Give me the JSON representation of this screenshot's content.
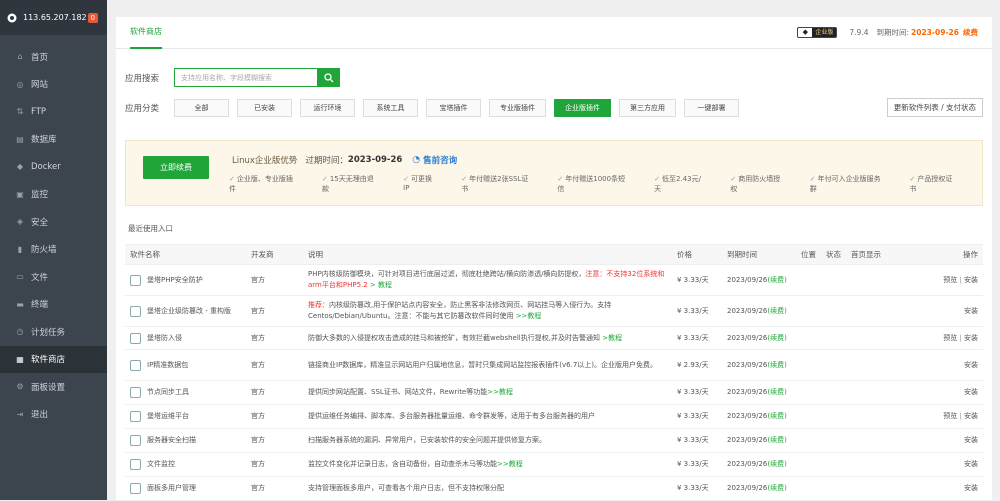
{
  "sidebar": {
    "ip": "113.65.207.182",
    "badge": "0",
    "items": [
      {
        "label": "首页",
        "icon": "home-icon",
        "glyph": "⌂"
      },
      {
        "label": "网站",
        "icon": "globe-icon",
        "glyph": "◎"
      },
      {
        "label": "FTP",
        "icon": "ftp-icon",
        "glyph": "⇅"
      },
      {
        "label": "数据库",
        "icon": "database-icon",
        "glyph": "▤"
      },
      {
        "label": "Docker",
        "icon": "docker-icon",
        "glyph": "◆"
      },
      {
        "label": "监控",
        "icon": "monitor-icon",
        "glyph": "▣"
      },
      {
        "label": "安全",
        "icon": "shield-icon",
        "glyph": "◈"
      },
      {
        "label": "防火墙",
        "icon": "firewall-icon",
        "glyph": "▮"
      },
      {
        "label": "文件",
        "icon": "folder-icon",
        "glyph": "▭"
      },
      {
        "label": "终端",
        "icon": "terminal-icon",
        "glyph": "▬"
      },
      {
        "label": "计划任务",
        "icon": "clock-icon",
        "glyph": "◷"
      },
      {
        "label": "软件商店",
        "icon": "grid-icon",
        "glyph": "▦"
      },
      {
        "label": "面板设置",
        "icon": "settings-icon",
        "glyph": "⚙"
      },
      {
        "label": "退出",
        "icon": "logout-icon",
        "glyph": "⇥"
      }
    ]
  },
  "header": {
    "tab": "软件商店",
    "edition_badge": "企业版",
    "version": "7.9.4",
    "expire_label": "到期时间:",
    "expire_date": "2023-09-26",
    "renew": "续费"
  },
  "search": {
    "label": "应用搜索",
    "placeholder": "支持应用名称、字段模糊搜索"
  },
  "categories": {
    "label": "应用分类",
    "items": [
      "全部",
      "已安装",
      "运行环境",
      "系统工具",
      "宝塔插件",
      "专业版插件",
      "企业版插件",
      "第三方应用",
      "一键部署"
    ],
    "active_index": 6,
    "update_button": "更新软件列表 / 支付状态"
  },
  "enterprise": {
    "renew_button": "立即续费",
    "title": "Linux企业版优势",
    "expire_label": "过期时间：",
    "expire_date": "2023-09-26",
    "consult": "售前咨询",
    "benefits": [
      "企业版、专业版插件",
      "15天无理由退款",
      "可更换IP",
      "年付赠送2张SSL证书",
      "年付赠送1000条短信",
      "低至2.43元/天",
      "商用防火墙授权",
      "年付可入企业版服务群",
      "产品授权证书"
    ]
  },
  "recent_label": "最近使用入口",
  "table": {
    "headers": [
      "软件名称",
      "开发商",
      "说明",
      "价格",
      "到期时间",
      "位置",
      "状态",
      "首页显示",
      "操作"
    ],
    "rows": [
      {
        "name": "堡塔PHP安全防护",
        "dev": "官方",
        "desc": "PHP内核级防御模块，可针对项目进行底层过滤，彻底杜绝跨站/横向防渗透/横向防提权，",
        "warn": "注意：不支持32位系统和arm平台和PHP5.2",
        "tail": " > 教程",
        "price": "¥ 3.33/天",
        "expire": "2023/09/26",
        "renew": "(续费)",
        "op1": "预览",
        "op2": "安装"
      },
      {
        "name": "堡塔企业级防篡改 - 重构版",
        "dev": "官方",
        "desc_prefix": "推荐：",
        "desc": "内核级防篡改,用于保护站点内容安全，防止黑客非法修改网页、网站挂马等入侵行为。支持Centos/Debian/Ubuntu。注意：不能与其它防篡改软件同时使用",
        "warn": "",
        "tail": " >>教程",
        "price": "¥ 3.33/天",
        "expire": "2023/09/26",
        "renew": "(续费)",
        "op1": "",
        "op2": "安装"
      },
      {
        "name": "堡塔防入侵",
        "dev": "官方",
        "desc": "防御大多数的入侵提权攻击造成的挂马和被挖矿，有效拦截webshell执行提权,并及时告警通知",
        "warn": "",
        "tail": " >教程",
        "price": "¥ 3.33/天",
        "expire": "2023/09/26",
        "renew": "(续费)",
        "op1": "预览",
        "op2": "安装"
      },
      {
        "name": "IP精准数据包",
        "dev": "官方",
        "desc": "链接商业IP数据库，精准显示网站用户归属地信息，暂时只集成网站监控报表插件(v6.7以上)。企业版用户免费。",
        "warn": "",
        "tail": "",
        "price": "¥ 2.93/天",
        "expire": "2023/09/26",
        "renew": "(续费)",
        "op1": "",
        "op2": "安装"
      },
      {
        "name": "节点同步工具",
        "dev": "官方",
        "desc": "提供同步网站配置、SSL证书、网站文件，Rewrite等功能",
        "warn": "",
        "tail": ">>教程",
        "price": "¥ 3.33/天",
        "expire": "2023/09/26",
        "renew": "(续费)",
        "op1": "",
        "op2": "安装"
      },
      {
        "name": "堡塔运维平台",
        "dev": "官方",
        "desc": "提供运维任务编排、脚本库、多台服务器批量运维、命令群发等，适用于有多台服务器的用户",
        "warn": "",
        "tail": "",
        "price": "¥ 3.33/天",
        "expire": "2023/09/26",
        "renew": "(续费)",
        "op1": "预览",
        "op2": "安装"
      },
      {
        "name": "服务器安全扫描",
        "dev": "官方",
        "desc": "扫描服务器系统的漏洞、异常用户，已安装软件的安全问题并提供修复方案。",
        "warn": "",
        "tail": "",
        "price": "¥ 3.33/天",
        "expire": "2023/09/26",
        "renew": "(续费)",
        "op1": "",
        "op2": "安装"
      },
      {
        "name": "文件监控",
        "dev": "官方",
        "desc": "监控文件变化并记录日志，含自动备份，自动查杀木马等功能",
        "warn": "",
        "tail": ">>教程",
        "price": "¥ 3.33/天",
        "expire": "2023/09/26",
        "renew": "(续费)",
        "op1": "",
        "op2": "安装"
      },
      {
        "name": "面板多用户管理",
        "dev": "官方",
        "desc": "支持管理面板多用户，可查看各个用户日志，但不支持权限分配",
        "warn": "",
        "tail": "",
        "price": "¥ 3.33/天",
        "expire": "2023/09/26",
        "renew": "(续费)",
        "op1": "",
        "op2": "安装"
      }
    ]
  }
}
